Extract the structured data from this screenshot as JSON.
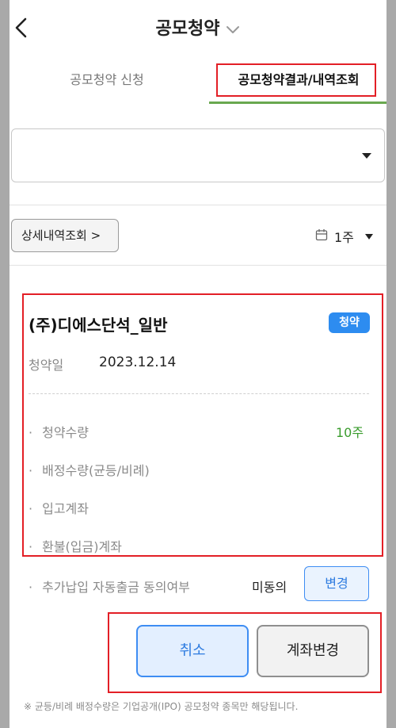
{
  "header": {
    "title": "공모청약"
  },
  "tabs": [
    {
      "label": "공모청약 신청"
    },
    {
      "label": "공모청약결과/내역조회"
    }
  ],
  "account_select": {
    "value": ""
  },
  "filter": {
    "detail_button": "상세내역조회 >",
    "period": "1주"
  },
  "card": {
    "stock_name": "(주)디에스단석_일반",
    "badge": "청약",
    "date_label": "청약일",
    "date_value": "2023.12.14",
    "rows": [
      {
        "label": "청약수량",
        "value": "10주"
      },
      {
        "label": "배정수량(균등/비례)",
        "value": ""
      },
      {
        "label": "입고계좌",
        "value": ""
      },
      {
        "label": "환불(입금)계좌",
        "value": ""
      }
    ]
  },
  "agreement": {
    "label": "추가납입 자동출금 동의여부",
    "value": "미동의",
    "change_button": "변경"
  },
  "actions": {
    "cancel": "취소",
    "change_account": "계좌변경"
  },
  "footnote": "※ 균등/비례 배정수량은 기업공개(IPO) 공모청약 종목만 해당됩니다.",
  "colors": {
    "accent_blue": "#2d8cf0",
    "tab_underline": "#69a84f",
    "quantity_green": "#3a9c2d",
    "highlight_red": "#e31f26"
  }
}
